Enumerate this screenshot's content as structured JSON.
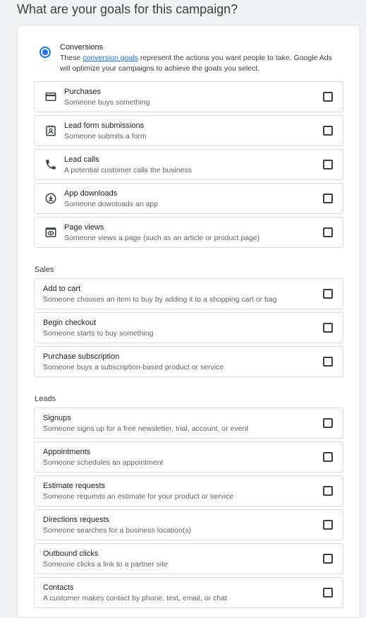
{
  "header": {
    "title": "What are your goals for this campaign?"
  },
  "conversions": {
    "title": "Conversions",
    "desc_before": "These ",
    "link_text": "conversion goals",
    "desc_after": " represent the actions you want people to take. Google Ads will optimize your campaigns to achieve the goals you select."
  },
  "primary_goals": [
    {
      "title": "Purchases",
      "desc": "Someone buys something",
      "icon": "credit-card-icon"
    },
    {
      "title": "Lead form submissions",
      "desc": "Someone submits a form",
      "icon": "contact-form-icon"
    },
    {
      "title": "Lead calls",
      "desc": "A potential customer calls the business",
      "icon": "phone-icon"
    },
    {
      "title": "App downloads",
      "desc": "Someone downloads an app",
      "icon": "download-circle-icon"
    },
    {
      "title": "Page views",
      "desc": "Someone views a page (such as an article or product page)",
      "icon": "view-page-icon"
    }
  ],
  "sales": {
    "label": "Sales",
    "items": [
      {
        "title": "Add to cart",
        "desc": "Someone chooses an item to buy by adding it to a shopping cart or bag"
      },
      {
        "title": "Begin checkout",
        "desc": "Someone starts to buy something"
      },
      {
        "title": "Purchase subscription",
        "desc": "Someone buys a subscription-based product or service"
      }
    ]
  },
  "leads": {
    "label": "Leads",
    "items": [
      {
        "title": "Signups",
        "desc": "Someone signs up for a free newsletter, trial, account, or event"
      },
      {
        "title": "Appointments",
        "desc": "Someone schedules an appointment"
      },
      {
        "title": "Estimate requests",
        "desc": "Someone requests an estimate for your product or service"
      },
      {
        "title": "Directions requests",
        "desc": "Someone searches for a business location(s)"
      },
      {
        "title": "Outbound clicks",
        "desc": "Someone clicks a link to a partner site"
      },
      {
        "title": "Contacts",
        "desc": "A customer makes contact by phone, text, email, or chat"
      }
    ]
  },
  "colors": {
    "accent": "#1a73e8",
    "border": "#dadce0",
    "background": "#f1f3f4"
  }
}
